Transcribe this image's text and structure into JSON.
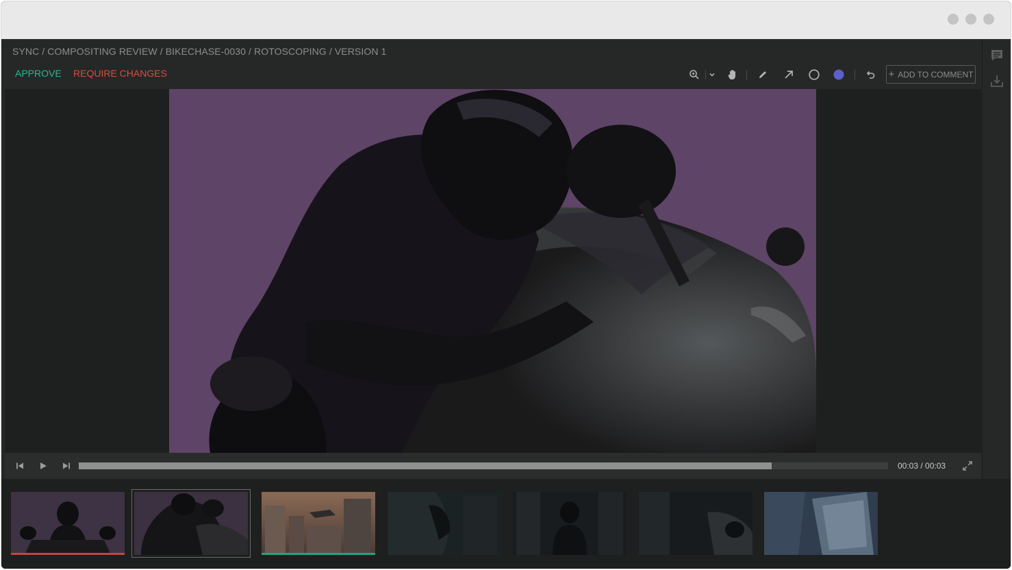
{
  "breadcrumb": "SYNC / COMPOSITING REVIEW / BIKECHASE-0030 / ROTOSCOPING / VERSION 1",
  "actions": {
    "approve": "APPROVE",
    "require_changes": "REQUIRE CHANGES"
  },
  "toolbar": {
    "add_to_comment": "ADD TO COMMENT",
    "icons": [
      "zoom-in-icon",
      "chevron-down-icon",
      "hand-icon",
      "pencil-icon",
      "arrow-icon",
      "circle-icon",
      "color-swatch-icon",
      "undo-icon"
    ],
    "selected_color": "#5b5fc7"
  },
  "sidebar": {
    "icons": [
      "comment-icon",
      "download-icon"
    ]
  },
  "player": {
    "timecode": "00:03 / 00:03",
    "progress": 0.856,
    "icons": [
      "skip-back-icon",
      "play-icon",
      "skip-forward-icon",
      "fullscreen-icon"
    ]
  },
  "colors": {
    "approve": "#1fbf8f",
    "require_changes": "#e2493f",
    "backdrop": "#5e4466"
  },
  "filmstrip": [
    {
      "status": "changes",
      "status_color": "#c0483d",
      "selected": false
    },
    {
      "status": "none",
      "selected": true
    },
    {
      "status": "approved",
      "status_color": "#1fa681",
      "selected": false
    },
    {
      "status": "none",
      "selected": false
    },
    {
      "status": "none",
      "selected": false
    },
    {
      "status": "none",
      "selected": false
    },
    {
      "status": "none",
      "selected": false
    }
  ]
}
